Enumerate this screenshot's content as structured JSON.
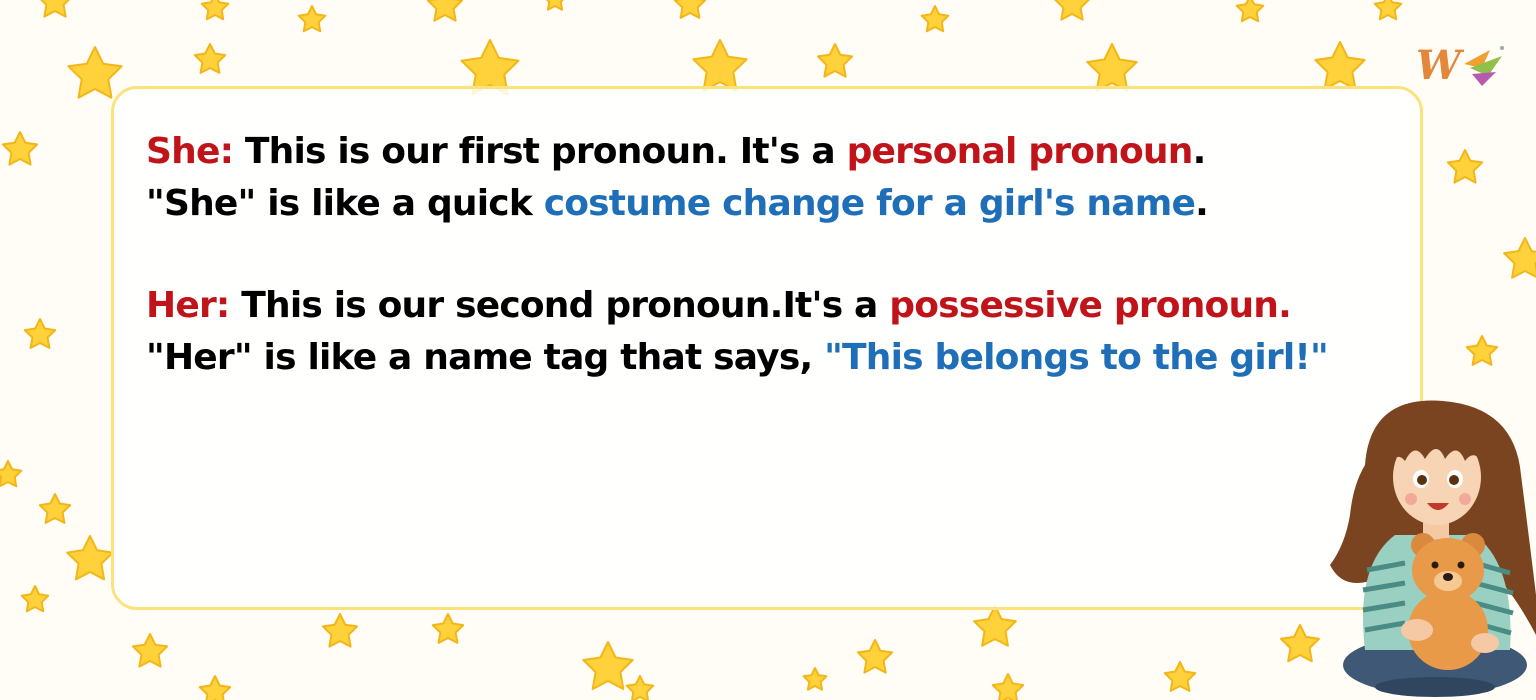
{
  "colors": {
    "keyword_red": "#c0141a",
    "highlight_blue": "#1f6fb8",
    "card_border": "#fbe27a",
    "star_yellow": "#ffd23c"
  },
  "paragraphs": {
    "she": {
      "keyword": "She:",
      "line1_text": " This is our first pronoun. It's a ",
      "line1_highlight": "personal pronoun",
      "line1_end": ".",
      "line2_text": "\"She\" is like a quick ",
      "line2_highlight": "costume change for a girl's name",
      "line2_end": "."
    },
    "her": {
      "keyword": "Her:",
      "line1_text": " This is our second pronoun.It's a ",
      "line1_highlight": "possessive pronoun.",
      "line2_text": "\"Her\" is like a name tag that says, ",
      "line2_highlight": "\"This belongs to the girl!\""
    }
  },
  "logo": {
    "icon": "w-logo-icon"
  },
  "illustration": {
    "icon": "girl-with-teddy-bear-icon"
  },
  "background": {
    "icon": "star-pattern-icon"
  }
}
